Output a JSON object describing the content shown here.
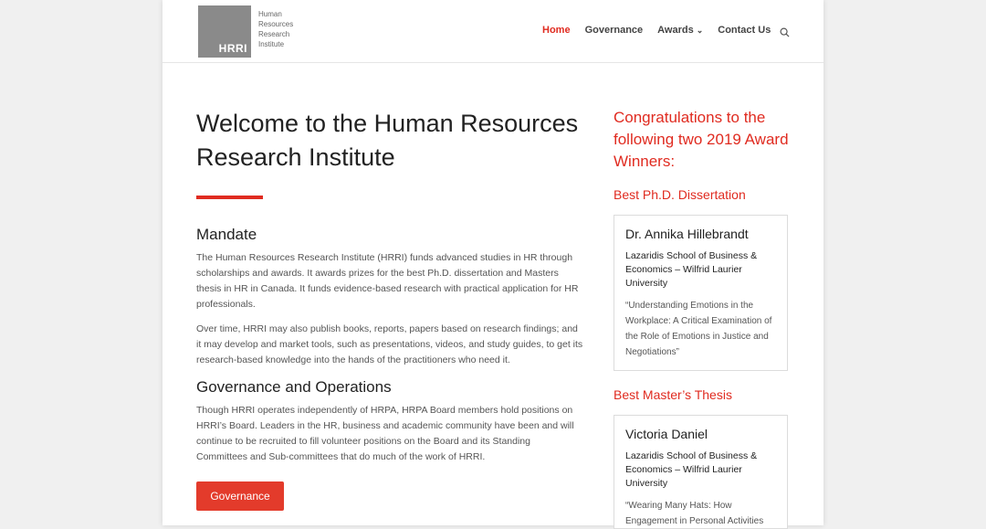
{
  "header": {
    "logo_abbr": "HRRI",
    "logo_lines": [
      "Human",
      "Resources",
      "Research",
      "Institute"
    ],
    "nav": {
      "home": "Home",
      "governance": "Governance",
      "awards": "Awards",
      "contact": "Contact Us"
    }
  },
  "main": {
    "title": "Welcome to the Human Resources Research Institute",
    "mandate_heading": "Mandate",
    "mandate_p1": "The Human Resources Research Institute (HRRI) funds advanced studies in HR through scholarships and awards. It awards prizes for the best Ph.D. dissertation and Masters thesis in HR in Canada. It funds evidence-based research with practical application for HR professionals.",
    "mandate_p2": "Over time, HRRI may also publish books, reports, papers based on research findings; and it may develop and market tools, such as presentations, videos, and study guides, to get its research-based knowledge into the hands of the practitioners who need it.",
    "gov_heading": "Governance and Operations",
    "gov_p1": "Though HRRI operates independently of HRPA, HRPA Board members hold positions on HRRI’s Board. Leaders in the HR, business and academic community have been and will continue to be recruited to fill volunteer positions on the Board and its Standing Committees and Sub-committees that do much of the work of HRRI.",
    "gov_button": "Governance"
  },
  "sidebar": {
    "title": "Congratulations to the following two 2019 Award Winners:",
    "phd_heading": "Best Ph.D. Dissertation",
    "phd_card": {
      "name": "Dr. Annika Hillebrandt",
      "affiliation": "Lazaridis School of Business & Economics – Wilfrid Laurier University",
      "quote": "“Understanding Emotions in the Workplace: A Critical Examination of the Role of Emotions in Justice and Negotiations”"
    },
    "masters_heading": "Best Master’s Thesis",
    "masters_card": {
      "name": "Victoria Daniel",
      "affiliation": "Lazaridis School of Business & Economics – Wilfrid Laurier University",
      "quote": "“Wearing Many Hats: How Engagement in Personal Activities"
    }
  }
}
